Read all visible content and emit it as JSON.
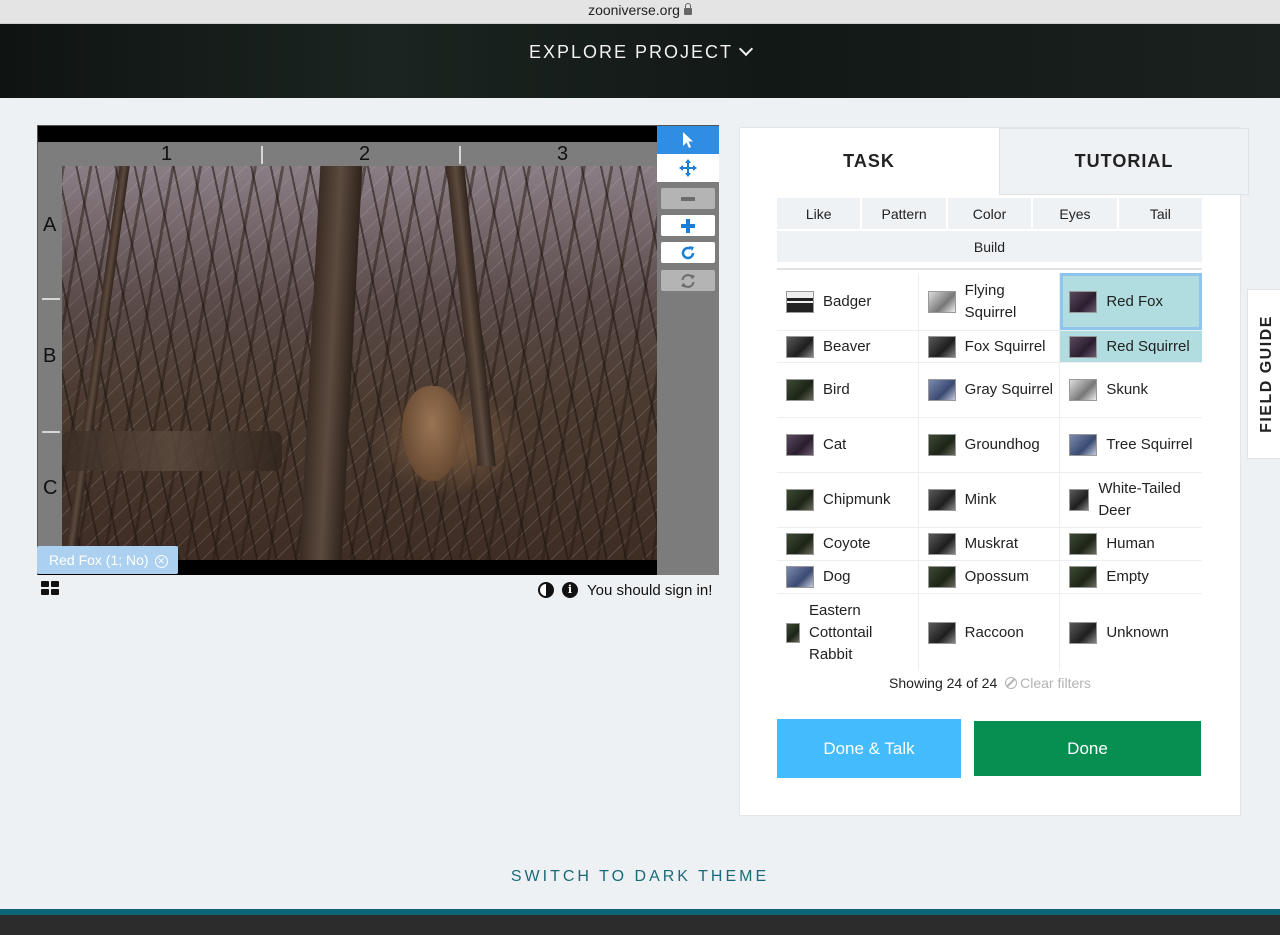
{
  "browser": {
    "url": "zooniverse.org"
  },
  "header": {
    "explore_label": "EXPLORE PROJECT"
  },
  "viewer": {
    "grid_columns": [
      "1",
      "2",
      "3"
    ],
    "grid_rows": [
      "A",
      "B",
      "C"
    ],
    "annotation_tag": "Red Fox (1; No)",
    "sign_in_message": "You should sign in!"
  },
  "panel": {
    "tabs": {
      "task": "TASK",
      "tutorial": "TUTORIAL"
    },
    "filters": {
      "row1": [
        "Like",
        "Pattern",
        "Color",
        "Eyes",
        "Tail"
      ],
      "row2": [
        "Build"
      ]
    },
    "choices": [
      [
        "Badger",
        "Flying Squirrel",
        "Red Fox"
      ],
      [
        "Beaver",
        "Fox Squirrel",
        "Red Squirrel"
      ],
      [
        "Bird",
        "Gray Squirrel",
        "Skunk"
      ],
      [
        "Cat",
        "Groundhog",
        "Tree Squirrel"
      ],
      [
        "Chipmunk",
        "Mink",
        "White-Tailed Deer"
      ],
      [
        "Coyote",
        "Muskrat",
        "Human"
      ],
      [
        "Dog",
        "Opossum",
        "Empty"
      ],
      [
        "Eastern Cottontail Rabbit",
        "Raccoon",
        "Unknown"
      ]
    ],
    "showing": "Showing 24 of 24",
    "clear_filters": "Clear filters",
    "done_talk_label": "Done & Talk",
    "done_label": "Done"
  },
  "field_guide_label": "FIELD GUIDE",
  "dark_theme_label": "SWITCH TO DARK THEME",
  "colors": {
    "done": "#078f52",
    "done_talk": "#43bbfd",
    "selected": "#b1dde0",
    "tool_active": "#2f8de4"
  }
}
